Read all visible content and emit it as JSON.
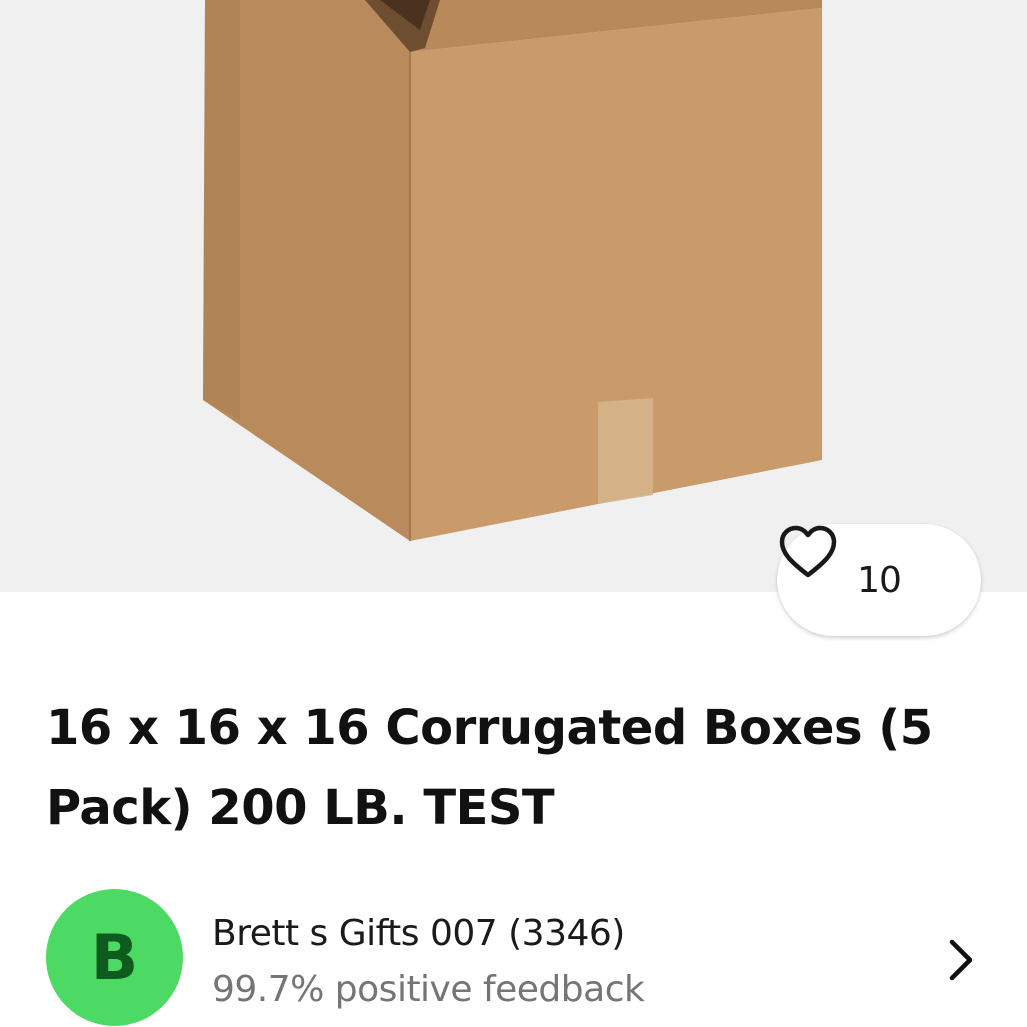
{
  "product": {
    "title": "16 x 16 x 16 Corrugated Boxes (5 Pack) 200 LB. TEST",
    "image_icon": "cardboard-box-photo",
    "watch_count": "10",
    "watch_icon": "heart-outline-icon"
  },
  "seller": {
    "avatar_letter": "B",
    "avatar_color": "#4cd964",
    "name": "Brett s Gifts 007 (3346)",
    "feedback": "99.7% positive feedback",
    "chevron_icon": "chevron-right-icon"
  }
}
